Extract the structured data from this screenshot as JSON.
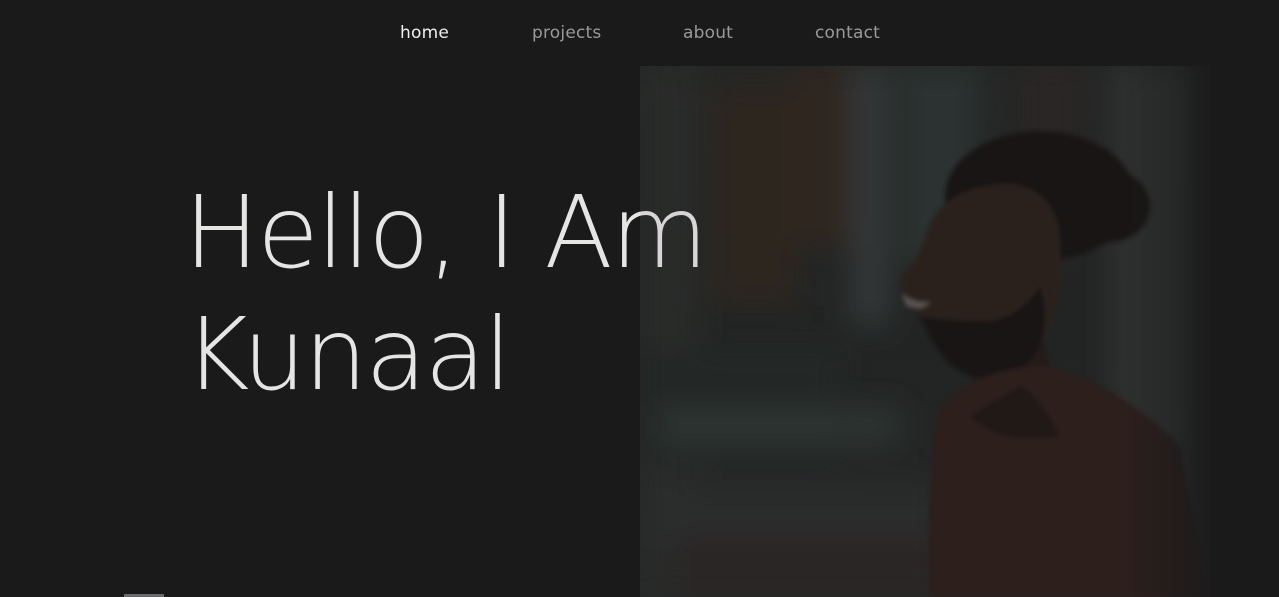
{
  "nav": {
    "items": [
      {
        "label": "home",
        "active": true
      },
      {
        "label": "projects",
        "active": false
      },
      {
        "label": "about",
        "active": false
      },
      {
        "label": "contact",
        "active": false
      }
    ]
  },
  "hero": {
    "title_line1": "Hello, I Am",
    "title_line2": "Kunaal"
  },
  "colors": {
    "background": "#1a1a1b",
    "text_primary": "#ffffff",
    "nav_inactive": "#9a9a9c"
  }
}
